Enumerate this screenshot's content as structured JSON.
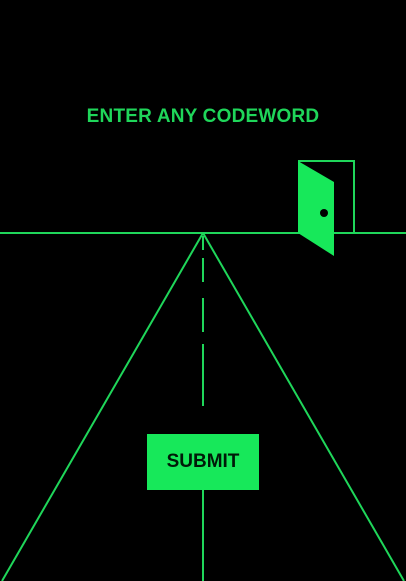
{
  "prompt_text": "ENTER ANY CODEWORD",
  "submit_label": "SUBMIT",
  "icons": {
    "door": "open-door-icon"
  },
  "colors": {
    "background": "#000000",
    "line": "#1fd65a",
    "button": "#17e85a",
    "button_text": "#001a08"
  }
}
